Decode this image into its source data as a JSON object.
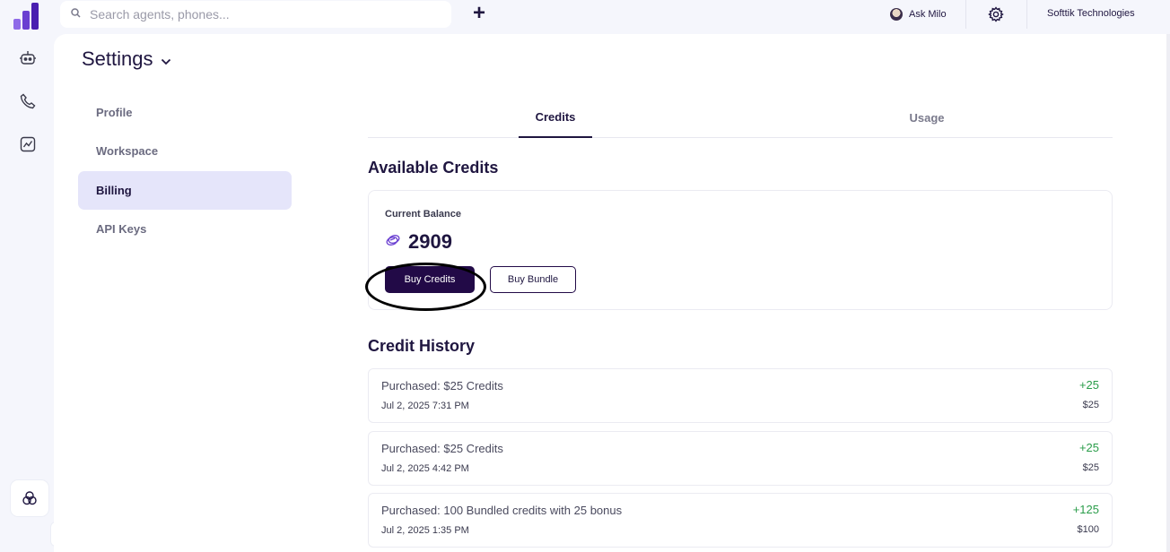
{
  "colors": {
    "brand": "#6a3fd1",
    "primary_button": "#220a47",
    "credit_positive": "#2a9d4a",
    "active_nav_bg": "#e5e5fa"
  },
  "rail": {
    "items": [
      {
        "icon": "robot-icon"
      },
      {
        "icon": "phone-icon"
      },
      {
        "icon": "analytics-icon"
      }
    ],
    "bottom_icon": "circles-icon",
    "expand_icon": "chevron-right-icon"
  },
  "topbar": {
    "search_placeholder": "Search agents, phones...",
    "add_icon": "+",
    "ask_label": "Ask Milo",
    "org_name": "Softtik Technologies"
  },
  "page": {
    "title": "Settings"
  },
  "nav": {
    "items": [
      {
        "label": "Profile"
      },
      {
        "label": "Workspace"
      },
      {
        "label": "Billing"
      },
      {
        "label": "API Keys"
      }
    ],
    "active": "Billing"
  },
  "tabs": [
    {
      "label": "Credits"
    },
    {
      "label": "Usage"
    }
  ],
  "credits": {
    "section_title": "Available Credits",
    "balance_label": "Current Balance",
    "balance_value": "2909",
    "buy_credits_label": "Buy Credits",
    "buy_bundle_label": "Buy Bundle"
  },
  "history": {
    "section_title": "Credit History",
    "items": [
      {
        "title": "Purchased: $25 Credits",
        "date": "Jul 2, 2025 7:31 PM",
        "credits": "+25",
        "amount": "$25"
      },
      {
        "title": "Purchased: $25 Credits",
        "date": "Jul 2, 2025 4:42 PM",
        "credits": "+25",
        "amount": "$25"
      },
      {
        "title": "Purchased: 100 Bundled credits with 25 bonus",
        "date": "Jul 2, 2025 1:35 PM",
        "credits": "+125",
        "amount": "$100"
      }
    ]
  }
}
